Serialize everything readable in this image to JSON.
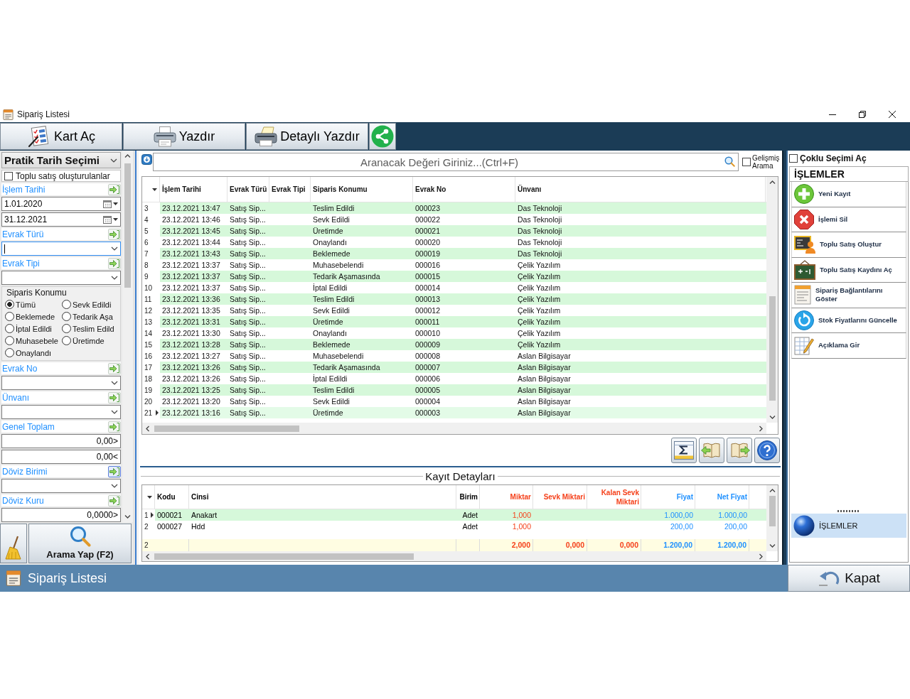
{
  "window": {
    "title": "Sipariş Listesi"
  },
  "toolbar": [
    {
      "kind": "card",
      "label": "Kart Aç"
    },
    {
      "kind": "print",
      "label": "Yazdır"
    },
    {
      "kind": "detail-print",
      "label": "Detaylı Yazdır"
    },
    {
      "kind": "share"
    }
  ],
  "filter_panel": {
    "preset": "Pratik Tarih Seçimi",
    "bulk": {
      "label": "Toplu satış oluşturulanlar",
      "checked": false
    },
    "sections": [
      {
        "kind": "field",
        "label": "İşlem Tarihi",
        "hover": false,
        "inputs": [
          {
            "kind": "date",
            "value": "1.01.2020",
            "focused": false
          },
          {
            "kind": "date",
            "value": "31.12.2021",
            "focused": false
          }
        ]
      },
      {
        "kind": "field",
        "label": "Evrak Türü",
        "hover": false,
        "inputs": [
          {
            "kind": "combo",
            "focused": true
          }
        ]
      },
      {
        "kind": "field",
        "label": "Evrak Tipi",
        "hover": false,
        "inputs": [
          {
            "kind": "combo",
            "focused": false
          }
        ]
      },
      {
        "kind": "radios",
        "title": "Siparis Konumu",
        "options": [
          {
            "label": "Tümü",
            "selected": true
          },
          {
            "label": "Sevk Edildi",
            "selected": false
          },
          {
            "label": "Beklemede",
            "selected": false
          },
          {
            "label": "Tedarik Aşa",
            "selected": false
          },
          {
            "label": "İptal Edildi",
            "selected": false
          },
          {
            "label": "Teslim Edild",
            "selected": false
          },
          {
            "label": "Muhasebele",
            "selected": false
          },
          {
            "label": "Üretimde",
            "selected": false
          },
          {
            "label": "Onaylandı",
            "selected": false
          }
        ]
      },
      {
        "kind": "field",
        "label": "Evrak No",
        "hover": false,
        "inputs": [
          {
            "kind": "combo",
            "focused": false
          }
        ]
      },
      {
        "kind": "field",
        "label": "Ünvanı",
        "hover": false,
        "inputs": [
          {
            "kind": "combo",
            "focused": false
          }
        ]
      },
      {
        "kind": "field",
        "label": "Genel Toplam",
        "hover": false,
        "inputs": [
          {
            "kind": "number",
            "value": "0,00>",
            "focused": false
          },
          {
            "kind": "number",
            "value": "0,00<",
            "focused": false
          }
        ]
      },
      {
        "kind": "field",
        "label": "Döviz Birimi",
        "hover": true,
        "inputs": [
          {
            "kind": "combo",
            "focused": false
          }
        ]
      },
      {
        "kind": "field",
        "label": "Döviz Kuru",
        "hover": false,
        "inputs": [
          {
            "kind": "number",
            "value": "0,0000>",
            "focused": false
          }
        ]
      }
    ],
    "actions": [
      {
        "kind": "clear"
      },
      {
        "kind": "search",
        "label": "Arama Yap (F2)"
      }
    ]
  },
  "search": {
    "placeholder": "Aranacak Değeri Giriniz...(Ctrl+F)",
    "advanced": {
      "label": "Gelişmiş Arama",
      "checked": false
    }
  },
  "orders": {
    "columns": [
      "İşlem Tarihi",
      "Evrak Türü",
      "Evrak Tipi",
      "Siparis Konumu",
      "Evrak No",
      "Ünvanı"
    ],
    "rows": [
      {
        "no": "3",
        "date": "23.12.2021 13:47",
        "doc_type": "Satış Sip...",
        "status": "Teslim Edildi",
        "doc_no": "000023",
        "company": "Das Teknoloji",
        "selected": false
      },
      {
        "no": "4",
        "date": "23.12.2021 13:46",
        "doc_type": "Satış Sip...",
        "status": "Sevk Edildi",
        "doc_no": "000022",
        "company": "Das Teknoloji",
        "selected": false
      },
      {
        "no": "5",
        "date": "23.12.2021 13:45",
        "doc_type": "Satış Sip...",
        "status": "Üretimde",
        "doc_no": "000021",
        "company": "Das Teknoloji",
        "selected": false
      },
      {
        "no": "6",
        "date": "23.12.2021 13:44",
        "doc_type": "Satış Sip...",
        "status": "Onaylandı",
        "doc_no": "000020",
        "company": "Das Teknoloji",
        "selected": false
      },
      {
        "no": "7",
        "date": "23.12.2021 13:43",
        "doc_type": "Satış Sip...",
        "status": "Beklemede",
        "doc_no": "000019",
        "company": "Das Teknoloji",
        "selected": false
      },
      {
        "no": "8",
        "date": "23.12.2021 13:37",
        "doc_type": "Satış Sip...",
        "status": "Muhasebelendi",
        "doc_no": "000016",
        "company": "Çelik Yazılım",
        "selected": false
      },
      {
        "no": "9",
        "date": "23.12.2021 13:37",
        "doc_type": "Satış Sip...",
        "status": "Tedarik Aşamasında",
        "doc_no": "000015",
        "company": "Çelik Yazılım",
        "selected": false
      },
      {
        "no": "10",
        "date": "23.12.2021 13:37",
        "doc_type": "Satış Sip...",
        "status": "İptal Edildi",
        "doc_no": "000014",
        "company": "Çelik Yazılım",
        "selected": false
      },
      {
        "no": "11",
        "date": "23.12.2021 13:36",
        "doc_type": "Satış Sip...",
        "status": "Teslim Edildi",
        "doc_no": "000013",
        "company": "Çelik Yazılım",
        "selected": false
      },
      {
        "no": "12",
        "date": "23.12.2021 13:35",
        "doc_type": "Satış Sip...",
        "status": "Sevk Edildi",
        "doc_no": "000012",
        "company": "Çelik Yazılım",
        "selected": false
      },
      {
        "no": "13",
        "date": "23.12.2021 13:31",
        "doc_type": "Satış Sip...",
        "status": "Üretimde",
        "doc_no": "000011",
        "company": "Çelik Yazılım",
        "selected": false
      },
      {
        "no": "14",
        "date": "23.12.2021 13:30",
        "doc_type": "Satış Sip...",
        "status": "Onaylandı",
        "doc_no": "000010",
        "company": "Çelik Yazılım",
        "selected": false
      },
      {
        "no": "15",
        "date": "23.12.2021 13:28",
        "doc_type": "Satış Sip...",
        "status": "Beklemede",
        "doc_no": "000009",
        "company": "Çelik Yazılım",
        "selected": false
      },
      {
        "no": "16",
        "date": "23.12.2021 13:27",
        "doc_type": "Satış Sip...",
        "status": "Muhasebelendi",
        "doc_no": "000008",
        "company": "Aslan Bilgisayar",
        "selected": false
      },
      {
        "no": "17",
        "date": "23.12.2021 13:26",
        "doc_type": "Satış Sip...",
        "status": "Tedarik Aşamasında",
        "doc_no": "000007",
        "company": "Aslan Bilgisayar",
        "selected": false
      },
      {
        "no": "18",
        "date": "23.12.2021 13:26",
        "doc_type": "Satış Sip...",
        "status": "İptal Edildi",
        "doc_no": "000006",
        "company": "Aslan Bilgisayar",
        "selected": false
      },
      {
        "no": "19",
        "date": "23.12.2021 13:25",
        "doc_type": "Satış Sip...",
        "status": "Teslim Edildi",
        "doc_no": "000005",
        "company": "Aslan Bilgisayar",
        "selected": false
      },
      {
        "no": "20",
        "date": "23.12.2021 13:20",
        "doc_type": "Satış Sip...",
        "status": "Sevk Edildi",
        "doc_no": "000004",
        "company": "Aslan Bilgisayar",
        "selected": false
      },
      {
        "no": "21",
        "date": "23.12.2021 13:16",
        "doc_type": "Satış Sip...",
        "status": "Üretimde",
        "doc_no": "000003",
        "company": "Aslan Bilgisayar",
        "selected": true
      }
    ]
  },
  "grid_buttons": [
    {
      "kind": "sum"
    },
    {
      "kind": "previous"
    },
    {
      "kind": "next"
    },
    {
      "kind": "help"
    }
  ],
  "details": {
    "title": "Kayıt Detayları",
    "columns": [
      {
        "label": "Kodu",
        "color": "#000000"
      },
      {
        "label": "Cinsi",
        "color": "#000000"
      },
      {
        "label": "Birim",
        "color": "#000000"
      },
      {
        "label": "Miktar",
        "color": "#f5401a"
      },
      {
        "label": "Sevk Miktari",
        "color": "#f5401a"
      },
      {
        "label": "Kalan Sevk Miktari",
        "color": "#f5401a"
      },
      {
        "label": "Fiyat",
        "color": "#1e90ff"
      },
      {
        "label": "Net Fiyat",
        "color": "#1e90ff"
      }
    ],
    "rows": [
      {
        "no": "1",
        "code": "000021",
        "name": "Anakart",
        "unit": "Adet",
        "quantity": "1,000",
        "price": "1.000,00",
        "net_price": "1.000,00",
        "selected": true
      },
      {
        "no": "2",
        "code": "000027",
        "name": "Hdd",
        "unit": "Adet",
        "quantity": "1,000",
        "price": "200,00",
        "net_price": "200,00",
        "selected": false
      }
    ],
    "totals": {
      "count": "2",
      "quantity": "2,000",
      "shipped": "0,000",
      "remaining": "0,000",
      "price": "1.200,00",
      "net_price": "1.200,00"
    }
  },
  "actions_panel": {
    "multi_select": {
      "label": "Çoklu Seçimi Aç",
      "checked": false
    },
    "title": "İŞLEMLER",
    "items": [
      {
        "kind": "add",
        "label": "Yeni Kayıt"
      },
      {
        "kind": "delete",
        "label": "İşlemi Sil"
      },
      {
        "kind": "bulk-create",
        "label": "Toplu Satış Oluştur"
      },
      {
        "kind": "bulk-open",
        "label": "Toplu Satış Kaydını Aç"
      },
      {
        "kind": "links",
        "label": "Sipariş Bağlantılarını Göster"
      },
      {
        "kind": "refresh",
        "label": "Stok Fiyatlarını Güncelle"
      },
      {
        "kind": "note",
        "label": "Açıklama Gir"
      }
    ],
    "nav": [
      {
        "label": "İŞLEMLER",
        "selected": true
      }
    ]
  },
  "status_bar": {
    "title": "Sipariş Listesi",
    "close": "Kapat"
  }
}
